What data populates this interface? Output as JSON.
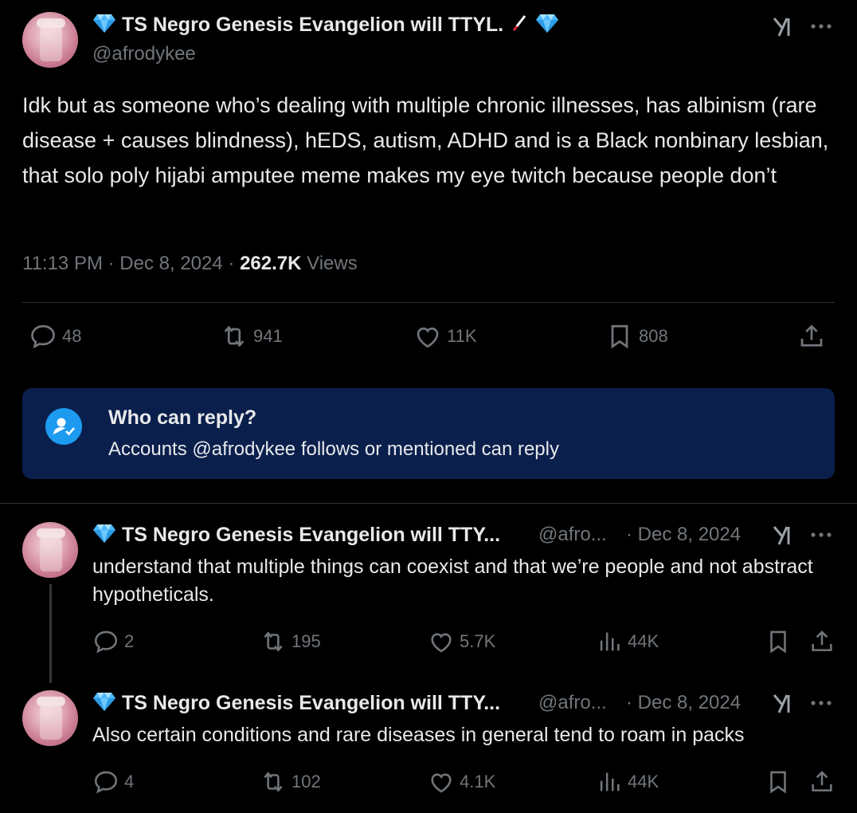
{
  "main_tweet": {
    "display_name": "TS Negro Genesis Evangelion will TTYL.",
    "handle": "@afrodykee",
    "text": "Idk but as someone who’s dealing with multiple chronic illnesses, has albinism (rare disease + causes blindness), hEDS, autism, ADHD and is a Black nonbinary lesbian, that solo poly hijabi amputee meme makes my eye twitch because people don’t",
    "time": "11:13 PM",
    "date": "Dec 8, 2024",
    "views_count": "262.7K",
    "views_label": "Views",
    "actions": {
      "replies": "48",
      "retweets": "941",
      "likes": "11K",
      "bookmarks": "808"
    }
  },
  "who_can_reply": {
    "title": "Who can reply?",
    "subtitle": "Accounts @afrodykee follows or mentioned can reply"
  },
  "replies": [
    {
      "display_name": "TS Negro Genesis Evangelion will TTY...",
      "handle": "@afro...",
      "date": "· Dec 8, 2024",
      "text": "understand that multiple things can coexist and that we’re people and not abstract hypotheticals.",
      "replies": "2",
      "retweets": "195",
      "likes": "5.7K",
      "views": "44K"
    },
    {
      "display_name": "TS Negro Genesis Evangelion will TTY...",
      "handle": "@afro...",
      "date": "· Dec 8, 2024",
      "text": "Also certain conditions and rare diseases in general tend to roam in packs",
      "replies": "4",
      "retweets": "102",
      "likes": "4.1K",
      "views": "44K"
    }
  ],
  "colors": {
    "background": "#000000",
    "text": "#e7e9ea",
    "muted": "#71767b",
    "divider": "#2f3336",
    "info_box": "#0b1f4d",
    "accent": "#1d9bf0",
    "gem": "#4db8ff"
  }
}
